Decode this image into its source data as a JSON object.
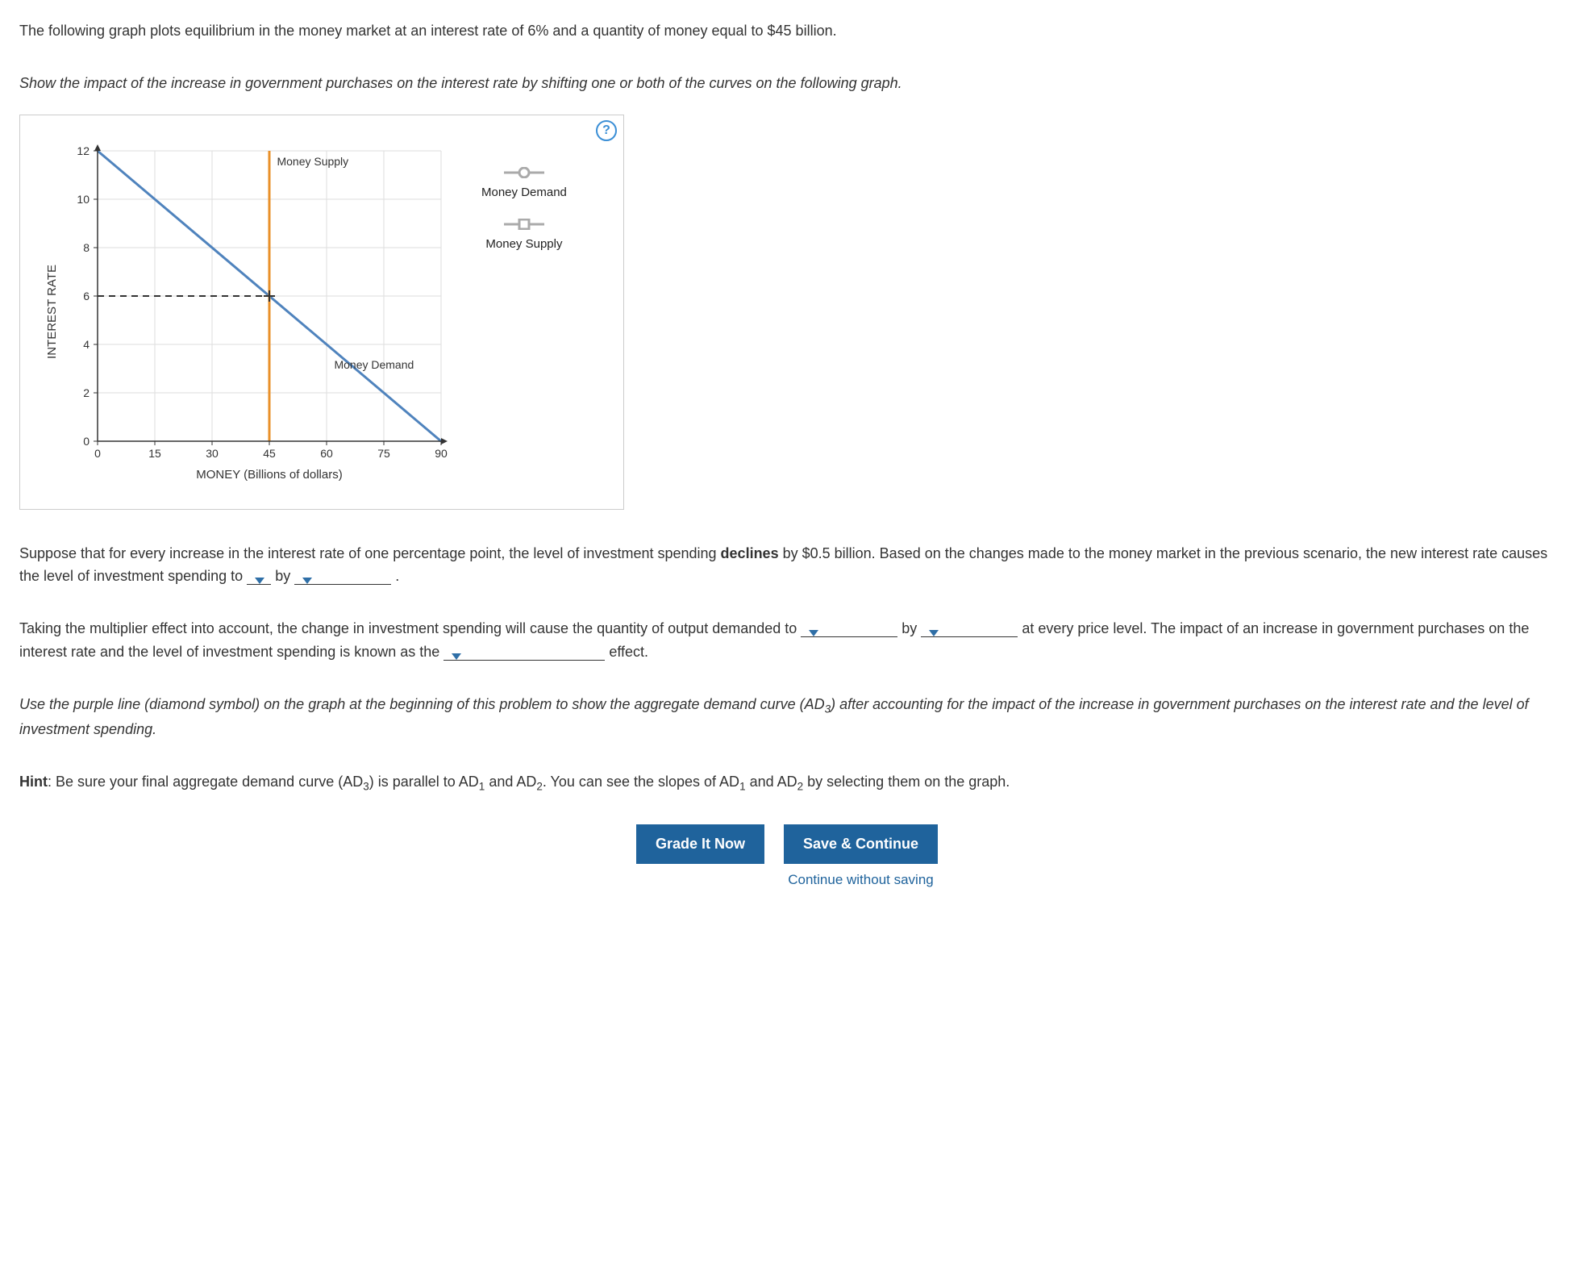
{
  "intro": "The following graph plots equilibrium in the money market at an interest rate of 6% and a quantity of money equal to $45 billion.",
  "instruction": "Show the impact of the increase in government purchases on the interest rate by shifting one or both of the curves on the following graph.",
  "help_icon": "?",
  "chart_data": {
    "type": "line",
    "xlabel": "MONEY (Billions of dollars)",
    "ylabel": "INTEREST RATE",
    "xlim": [
      0,
      90
    ],
    "ylim": [
      0,
      12
    ],
    "x_ticks": [
      0,
      15,
      30,
      45,
      60,
      75,
      90
    ],
    "y_ticks": [
      0,
      2,
      4,
      6,
      8,
      10,
      12
    ],
    "series": [
      {
        "name": "Money Demand",
        "color": "#4f83bd",
        "marker": "circle",
        "points": [
          [
            0,
            12
          ],
          [
            90,
            0
          ]
        ]
      },
      {
        "name": "Money Supply",
        "color": "#e9902a",
        "marker": "square",
        "points": [
          [
            45,
            0
          ],
          [
            45,
            12
          ]
        ]
      }
    ],
    "equilibrium": {
      "x": 45,
      "y": 6,
      "dashed_from_y_axis": true
    },
    "annotations": [
      {
        "text": "Money Supply",
        "x": 47,
        "y": 11.4
      },
      {
        "text": "Money Demand",
        "x": 62,
        "y": 3
      }
    ]
  },
  "legend": {
    "demand": "Money Demand",
    "supply": "Money Supply"
  },
  "para1_a": "Suppose that for every increase in the interest rate of one percentage point, the level of investment spending ",
  "para1_b": " by $0.5 billion. Based on the changes made to the money market in the previous scenario, the new interest rate causes the level of investment spending to ",
  "declines": "declines",
  "by1": " by ",
  "period": " .",
  "para2_a": "Taking the multiplier effect into account, the change in investment spending will cause the quantity of output demanded to ",
  "by2": " by ",
  "para2_b": " at every price level. The impact of an increase in government purchases on the interest rate and the level of investment spending is known as the ",
  "effect": " effect.",
  "para3": "Use the purple line (diamond symbol) on the graph at the beginning of this problem to show the aggregate demand curve (AD",
  "para3_sub": "3",
  "para3_b": ") after accounting for the impact of the increase in government purchases on the interest rate and the level of investment spending.",
  "hint_label": "Hint",
  "hint_a": ": Be sure your final aggregate demand curve (AD",
  "hint_b": ") is parallel to AD",
  "hint_c": " and AD",
  "hint_d": ". You can see the slopes of AD",
  "hint_e": " by selecting them on the graph.",
  "sub1": "1",
  "sub2": "2",
  "sub3": "3",
  "buttons": {
    "grade": "Grade It Now",
    "save": "Save & Continue",
    "continue": "Continue without saving"
  }
}
